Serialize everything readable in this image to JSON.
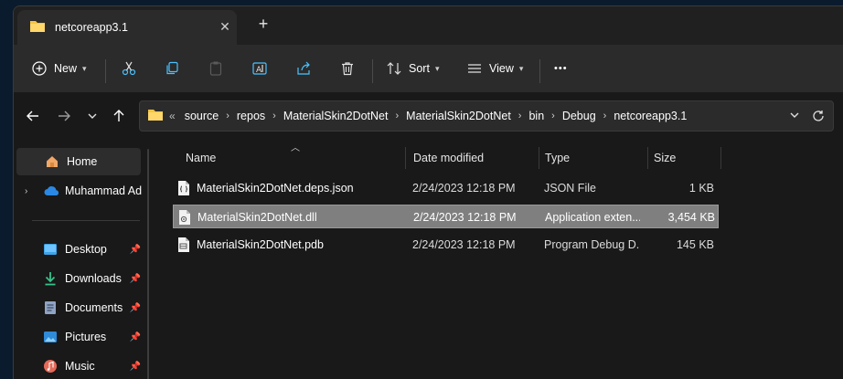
{
  "window": {
    "tab_title": "netcoreapp3.1",
    "tab_close": "✕",
    "new_tab": "+"
  },
  "toolbar": {
    "new_label": "New",
    "sort_label": "Sort",
    "view_label": "View",
    "more_label": "•••"
  },
  "address": {
    "overflow": "«",
    "crumbs": [
      "source",
      "repos",
      "MaterialSkin2DotNet",
      "MaterialSkin2DotNet",
      "bin",
      "Debug",
      "netcoreapp3.1"
    ]
  },
  "sidebar": {
    "home": "Home",
    "onedrive": "Muhammad Ad",
    "quick": [
      {
        "label": "Desktop",
        "icon": "desktop-icon"
      },
      {
        "label": "Downloads",
        "icon": "download-icon"
      },
      {
        "label": "Documents",
        "icon": "document-icon"
      },
      {
        "label": "Pictures",
        "icon": "pictures-icon"
      },
      {
        "label": "Music",
        "icon": "music-icon"
      }
    ]
  },
  "columns": {
    "name": "Name",
    "date": "Date modified",
    "type": "Type",
    "size": "Size"
  },
  "files": [
    {
      "name": "MaterialSkin2DotNet.deps.json",
      "date": "2/24/2023 12:18 PM",
      "type": "JSON File",
      "size": "1 KB",
      "icon": "json-file-icon"
    },
    {
      "name": "MaterialSkin2DotNet.dll",
      "date": "2/24/2023 12:18 PM",
      "type": "Application exten...",
      "size": "3,454 KB",
      "icon": "dll-file-icon",
      "selected": true
    },
    {
      "name": "MaterialSkin2DotNet.pdb",
      "date": "2/24/2023 12:18 PM",
      "type": "Program Debug D...",
      "size": "145 KB",
      "icon": "pdb-file-icon"
    }
  ],
  "colors": {
    "folder": "#f5c542",
    "accent": "#4cc2ff",
    "selection": "#7f7f7f"
  }
}
